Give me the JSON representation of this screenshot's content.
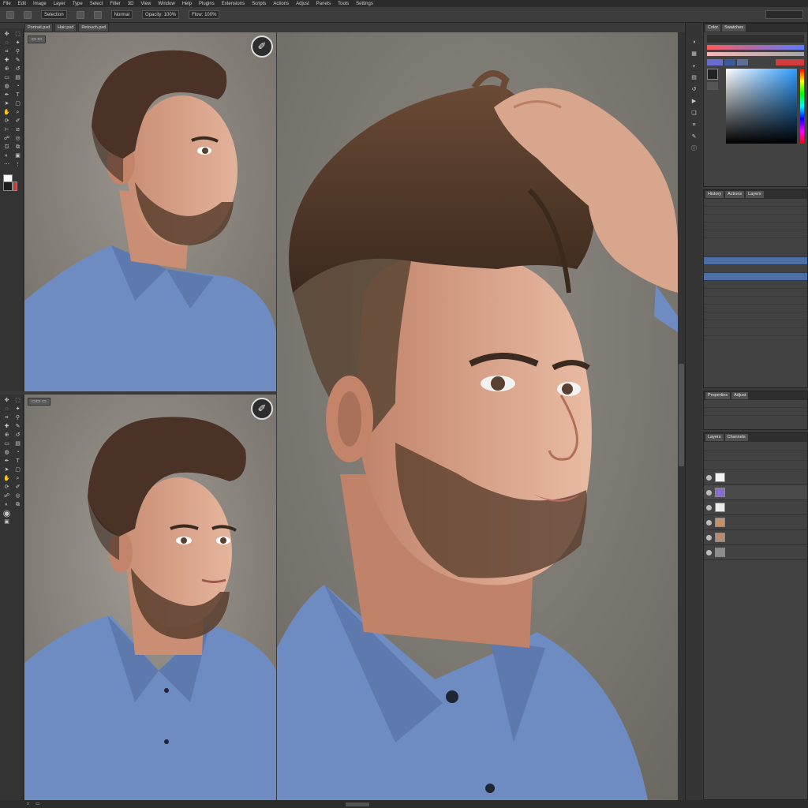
{
  "menu": [
    "File",
    "Edit",
    "Image",
    "Layer",
    "Type",
    "Select",
    "Filter",
    "3D",
    "View",
    "Window",
    "Help",
    "Plugins",
    "Extensions",
    "Scripts",
    "Actions",
    "Adjust",
    "Panels",
    "Tools",
    "Settings"
  ],
  "options_bar": {
    "field1": "Selection",
    "field2": "Normal",
    "field3": "Opacity: 100%",
    "field4": "Flow: 100%"
  },
  "doc_tabs": [
    "Portrait.psd",
    "Hair.psd",
    "Retouch.psd"
  ],
  "panels": {
    "top_tabs": [
      "Color",
      "Swatches"
    ],
    "hist_tabs": [
      "History",
      "Actions",
      "Layers"
    ],
    "props_tabs": [
      "Properties",
      "Adjust"
    ],
    "layers_tabs": [
      "Layers",
      "Channels"
    ]
  },
  "colors": {
    "app_bg": "#3a3a3a",
    "panel_bg": "#424242",
    "selection_blue": "#4e6ea6",
    "shirt": "#6f8cc2",
    "hair": "#4a3326",
    "skin": "#d9a58d",
    "canvas_bg": "#7e7a74"
  },
  "icons": [
    "move-icon",
    "marquee-icon",
    "lasso-icon",
    "brush-icon",
    "eraser-icon",
    "zoom-icon",
    "hand-icon",
    "eye-icon",
    "brush-tool-icon"
  ]
}
